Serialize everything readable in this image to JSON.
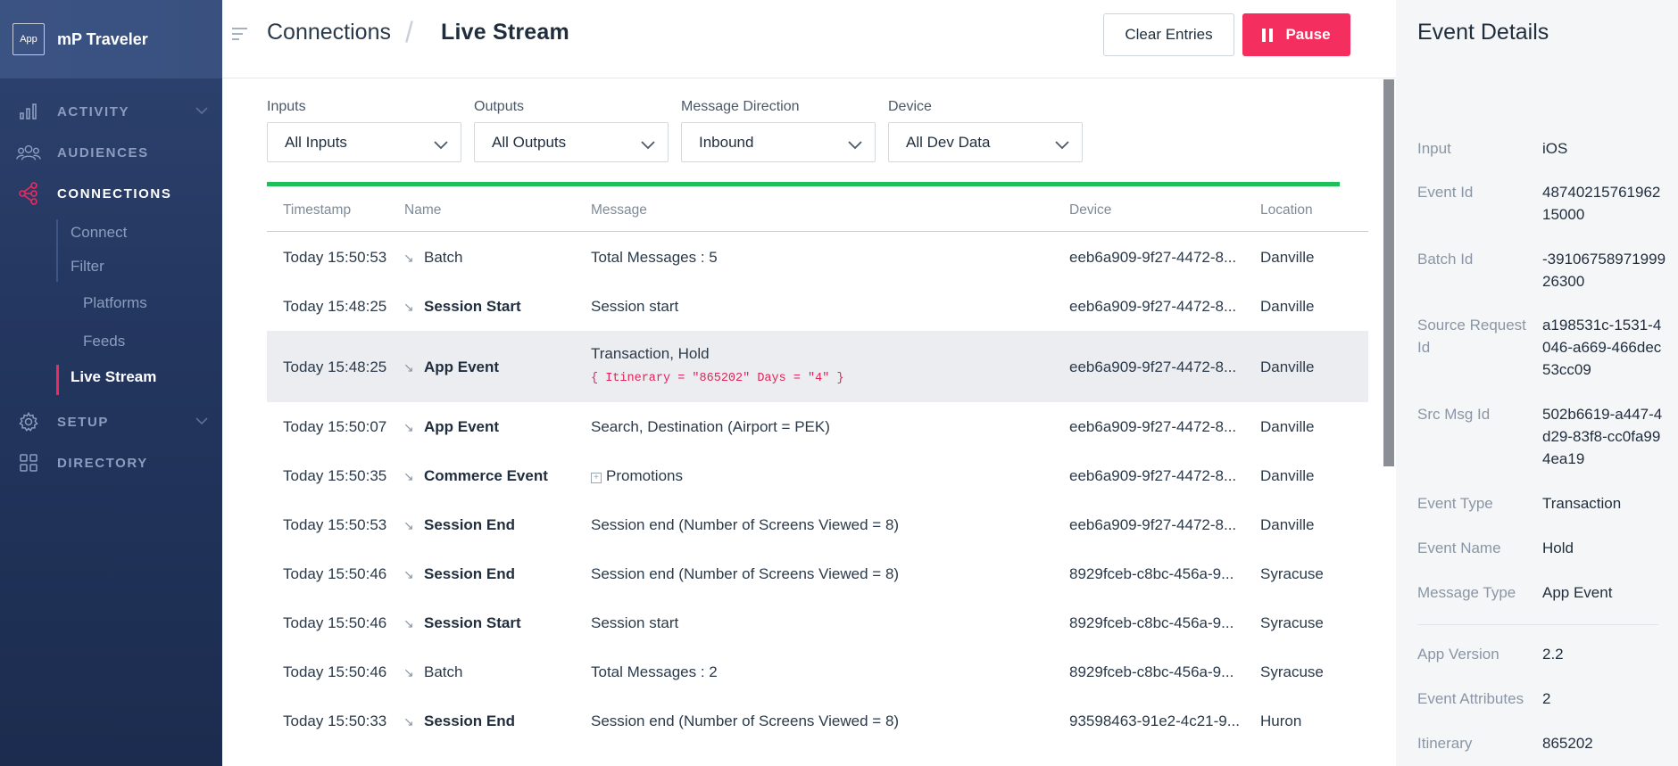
{
  "brand": {
    "logo_text": "App",
    "name": "mP Traveler"
  },
  "nav": {
    "activity": "ACTIVITY",
    "audiences": "AUDIENCES",
    "connections": "CONNECTIONS",
    "setup": "SETUP",
    "directory": "DIRECTORY",
    "sub": {
      "connect": "Connect",
      "filter": "Filter",
      "platforms": "Platforms",
      "feeds": "Feeds",
      "live_stream": "Live Stream"
    }
  },
  "header": {
    "breadcrumb_parent": "Connections",
    "breadcrumb_sep": "/",
    "title": "Live Stream",
    "clear_label": "Clear Entries",
    "pause_label": "Pause"
  },
  "filters": {
    "inputs": {
      "label": "Inputs",
      "value": "All Inputs"
    },
    "outputs": {
      "label": "Outputs",
      "value": "All Outputs"
    },
    "direction": {
      "label": "Message Direction",
      "value": "Inbound"
    },
    "device": {
      "label": "Device",
      "value": "All Dev Data"
    }
  },
  "progress": 1.0,
  "colors": {
    "accent": "#f42e5e",
    "progress": "#1fbf5a",
    "sidebar": "#243760"
  },
  "table": {
    "headers": {
      "timestamp": "Timestamp",
      "name": "Name",
      "message": "Message",
      "device": "Device",
      "location": "Location"
    },
    "rows": [
      {
        "ts": "Today 15:50:53",
        "name": "Batch",
        "msg": "Total Messages : 5",
        "device": "eeb6a909-9f27-4472-8...",
        "loc": "Danville"
      },
      {
        "ts": "Today 15:48:25",
        "name": "Session Start",
        "msg": "Session start",
        "device": "eeb6a909-9f27-4472-8...",
        "loc": "Danville"
      },
      {
        "ts": "Today 15:48:25",
        "name": "App Event",
        "msg": "Transaction, Hold",
        "attrs": "{ Itinerary = \"865202\" Days = \"4\" }",
        "device": "eeb6a909-9f27-4472-8...",
        "loc": "Danville"
      },
      {
        "ts": "Today 15:50:07",
        "name": "App Event",
        "msg": "Search, Destination (Airport = PEK)",
        "device": "eeb6a909-9f27-4472-8...",
        "loc": "Danville"
      },
      {
        "ts": "Today 15:50:35",
        "name": "Commerce Event",
        "msg": "Promotions",
        "device": "eeb6a909-9f27-4472-8...",
        "loc": "Danville"
      },
      {
        "ts": "Today 15:50:53",
        "name": "Session End",
        "msg": "Session end (Number of Screens Viewed = 8)",
        "device": "eeb6a909-9f27-4472-8...",
        "loc": "Danville"
      },
      {
        "ts": "Today 15:50:46",
        "name": "Session End",
        "msg": "Session end (Number of Screens Viewed = 8)",
        "device": "8929fceb-c8bc-456a-9...",
        "loc": "Syracuse"
      },
      {
        "ts": "Today 15:50:46",
        "name": "Session Start",
        "msg": "Session start",
        "device": "8929fceb-c8bc-456a-9...",
        "loc": "Syracuse"
      },
      {
        "ts": "Today 15:50:46",
        "name": "Batch",
        "msg": "Total Messages : 2",
        "device": "8929fceb-c8bc-456a-9...",
        "loc": "Syracuse"
      },
      {
        "ts": "Today 15:50:33",
        "name": "Session End",
        "msg": "Session end (Number of Screens Viewed = 8)",
        "device": "93598463-91e2-4c21-9...",
        "loc": "Huron"
      }
    ]
  },
  "details": {
    "title": "Event Details",
    "fields": [
      {
        "key": "Input",
        "value": "iOS"
      },
      {
        "key": "Event Id",
        "value": "4874021576196215000"
      },
      {
        "key": "Batch Id",
        "value": "-3910675897199926300"
      },
      {
        "key": "Source Request Id",
        "value": "a198531c-1531-4046-a669-466dec53cc09"
      },
      {
        "key": "Src Msg Id",
        "value": "502b6619-a447-4d29-83f8-cc0fa994ea19"
      },
      {
        "key": "Event Type",
        "value": "Transaction"
      },
      {
        "key": "Event Name",
        "value": "Hold"
      },
      {
        "key": "Message Type",
        "value": "App Event"
      },
      {
        "key": "App Version",
        "value": "2.2"
      },
      {
        "key": "Event Attributes",
        "value": "2"
      },
      {
        "key": "Itinerary",
        "value": "865202"
      }
    ]
  }
}
